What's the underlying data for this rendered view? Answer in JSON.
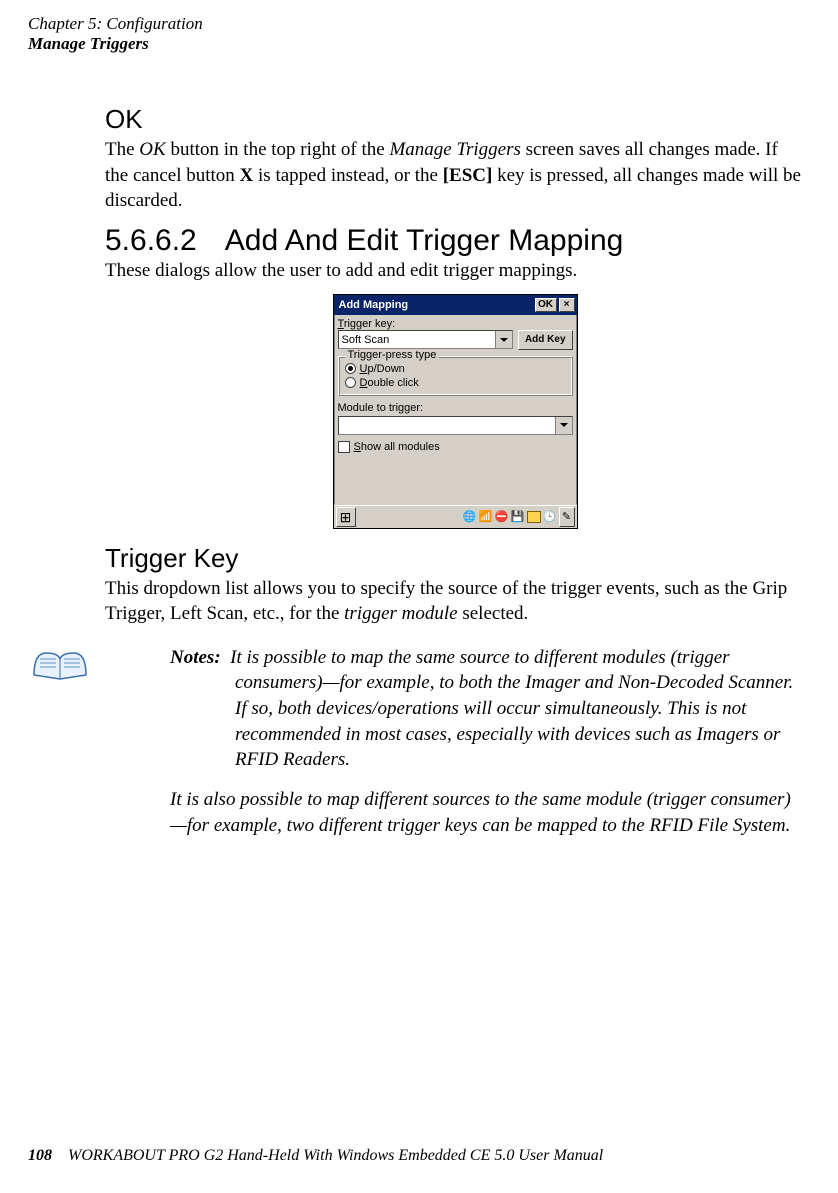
{
  "header": {
    "chapter": "Chapter 5: Configuration",
    "section": "Manage Triggers"
  },
  "ok_heading": "OK",
  "ok_para_1": "The ",
  "ok_para_2": "OK",
  "ok_para_3": " button in the top right of the ",
  "ok_para_4": "Manage Triggers",
  "ok_para_5": " screen saves all changes made. If the cancel button ",
  "ok_para_6": "X",
  "ok_para_7": " is tapped instead, or the ",
  "ok_para_8": "[ESC]",
  "ok_para_9": " key is pressed, all changes made will be discarded.",
  "subsection_num": "5.6.6.2",
  "subsection_title": "Add And Edit Trigger Mapping",
  "subsection_intro": "These dialogs allow the user to add and edit trigger mappings.",
  "trigger_key_heading": "Trigger Key",
  "trigger_key_para_1": "This dropdown list allows you to specify the source of the trigger events, such as the Grip Trigger, Left Scan, etc., for the ",
  "trigger_key_para_2": "trigger module",
  "trigger_key_para_3": " selected.",
  "notes_label": "Notes:",
  "notes_p1": "It is possible to map the same source to different modules (trigger consumers)—for example, to both the Imager and Non-Decoded Scanner. If so, both devices/operations will occur simultaneously. This is not recommended in most cases, especially with devices such as Imagers or RFID Readers.",
  "notes_p2": "It is also possible to map different sources to the same module (trigger consumer)—for example, two different trigger keys can be mapped to the RFID File System.",
  "footer_page": "108",
  "footer_text": "WORKABOUT PRO G2 Hand-Held With Windows Embedded CE 5.0 User Manual",
  "dialog": {
    "title": "Add Mapping",
    "ok": "OK",
    "close": "×",
    "trigger_key_label_pre": "T",
    "trigger_key_label_post": "rigger key:",
    "trigger_key_value": "Soft Scan",
    "add_key": "Add Key",
    "group_title": "Trigger-press type",
    "radio1_pre": "U",
    "radio1_post": "p/Down",
    "radio2_pre": "D",
    "radio2_post": "ouble click",
    "module_label": "Module to trigger:",
    "module_value": "",
    "show_all_pre": "S",
    "show_all_post": "how all modules"
  }
}
